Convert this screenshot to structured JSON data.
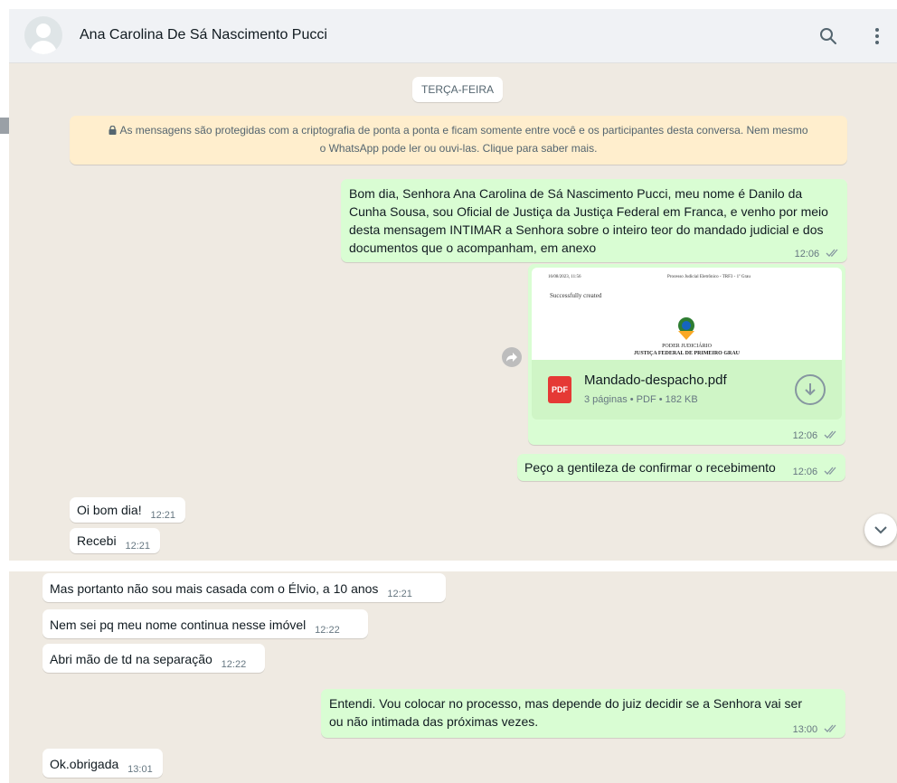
{
  "header": {
    "contact_name": "Ana Carolina De Sá Nascimento Pucci"
  },
  "date_separator": "TERÇA-FEIRA",
  "encryption_notice": {
    "line1": "As mensagens são protegidas com a criptografia de ponta a ponta e ficam somente entre você e os participantes desta conversa. Nem mesmo",
    "line2": "o WhatsApp pode ler ou ouvi-las. Clique para saber mais."
  },
  "messages": [
    {
      "direction": "out",
      "text": "Bom dia, Senhora Ana Carolina de Sá Nascimento Pucci, meu nome é Danilo da Cunha Sousa, sou Oficial de Justiça da Justiça Federal em Franca, e venho por meio desta mensagem INTIMAR  a Senhora sobre o inteiro teor do mandado judicial e dos documentos que o acompanham, em anexo",
      "time": "12:06"
    },
    {
      "direction": "out",
      "type": "document",
      "file_name": "Mandado-despacho.pdf",
      "file_info": "3 páginas • PDF • 182 KB",
      "preview_header_left": "16/08/2023, 11:56",
      "preview_header_right": "Processo Judicial Eletrônico - TRF3 - 1º Grau",
      "preview_status": "Successfully created",
      "preview_org1": "PODER JUDICIÁRIO",
      "preview_org2": "JUSTIÇA FEDERAL DE PRIMEIRO GRAU",
      "file_type_badge": "PDF",
      "time": "12:06"
    },
    {
      "direction": "out",
      "text": "Peço a gentileza de confirmar o recebimento",
      "time": "12:06"
    },
    {
      "direction": "in",
      "text": "Oi bom dia!",
      "time": "12:21"
    },
    {
      "direction": "in",
      "text": "Recebi",
      "time": "12:21"
    },
    {
      "direction": "in",
      "text": "Mas portanto não sou mais casada com o Élvio,  a 10 anos",
      "time": "12:21"
    },
    {
      "direction": "in",
      "text": "Nem sei pq meu nome continua nesse imóvel",
      "time": "12:22"
    },
    {
      "direction": "in",
      "text": "Abri mão de td na separação",
      "time": "12:22"
    },
    {
      "direction": "out",
      "text": "Entendi. Vou colocar no processo, mas depende do juiz decidir se a Senhora vai ser ou não intimada das próximas vezes.",
      "time": "13:00"
    },
    {
      "direction": "in",
      "text": "Ok.obrigada",
      "time": "13:01"
    }
  ],
  "colors": {
    "outgoing_bubble": "#d9fdd3",
    "incoming_bubble": "#ffffff",
    "chat_background": "#efeae2",
    "encryption_notice": "#ffeecd",
    "read_ticks": "#8696a0"
  },
  "icons": [
    "search-icon",
    "menu-icon",
    "lock-icon",
    "pdf-icon",
    "download-icon",
    "forward-icon",
    "chevron-down-icon",
    "double-check-icon"
  ]
}
